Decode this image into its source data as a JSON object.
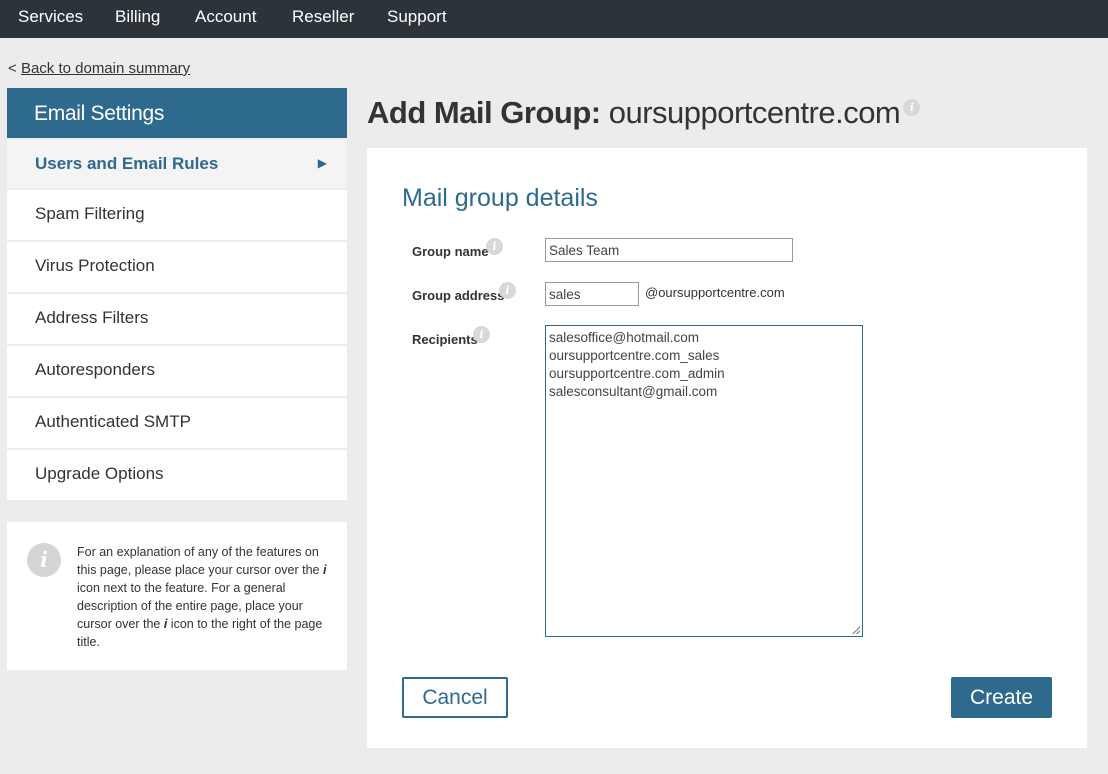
{
  "topnav": {
    "items": [
      {
        "label": "Services"
      },
      {
        "label": "Billing"
      },
      {
        "label": "Account"
      },
      {
        "label": "Reseller"
      },
      {
        "label": "Support"
      }
    ]
  },
  "back": {
    "prefix": "<",
    "label": "Back to domain summary"
  },
  "sidebar": {
    "title": "Email Settings",
    "items": [
      {
        "label": "Users and Email Rules",
        "active": true
      },
      {
        "label": "Spam Filtering"
      },
      {
        "label": "Virus Protection"
      },
      {
        "label": "Address Filters"
      },
      {
        "label": "Autoresponders"
      },
      {
        "label": "Authenticated SMTP"
      },
      {
        "label": "Upgrade Options"
      }
    ],
    "active_arrow": "▶"
  },
  "help": {
    "icon": "i",
    "text_part1": "For an explanation of any of the features on this page, please place your cursor over the ",
    "icon_letter_1": "i",
    "text_part2": " icon next to the feature. For a general description of the entire page, place your cursor over the ",
    "icon_letter_2": "i",
    "text_part3": " icon to the right of the page title."
  },
  "page": {
    "title_prefix": "Add Mail Group:",
    "title_domain": "oursupportcentre.com"
  },
  "form": {
    "section_title": "Mail group details",
    "group_name_label": "Group name",
    "group_name_value": "Sales Team",
    "group_address_label": "Group address",
    "group_address_value": "sales",
    "group_address_suffix": "@oursupportcentre.com",
    "recipients_label": "Recipients",
    "recipients": [
      "salesoffice@hotmail.com",
      "oursupportcentre.com_sales",
      "oursupportcentre.com_admin",
      "salesconsultant@gmail.com"
    ],
    "cancel_label": "Cancel",
    "create_label": "Create"
  },
  "icons": {
    "info": "i"
  },
  "colors": {
    "brand": "#2e6a8e",
    "topnav_bg": "#2d3439",
    "page_bg": "#ececec"
  }
}
